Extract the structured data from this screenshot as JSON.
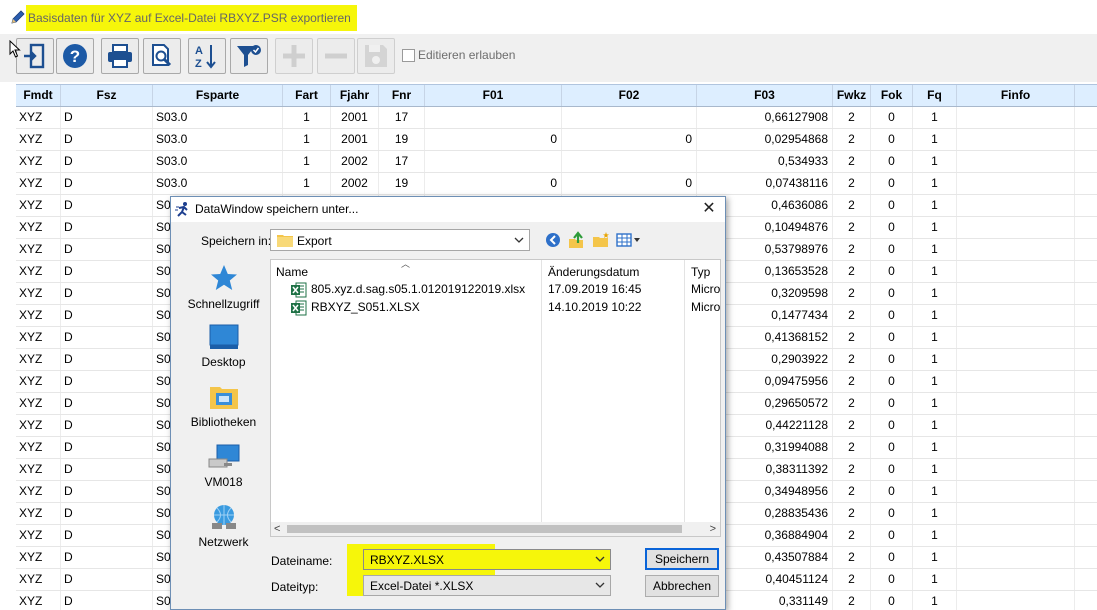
{
  "window": {
    "title": "Basisdaten für XYZ auf Excel-Datei RBXYZ.PSR exportieren"
  },
  "toolbar": {
    "buttons": [
      {
        "name": "exit",
        "icon": "exit-door-icon"
      },
      {
        "name": "help",
        "icon": "help-icon"
      },
      {
        "name": "print",
        "icon": "printer-icon"
      },
      {
        "name": "preview",
        "icon": "print-preview-icon"
      },
      {
        "name": "sort",
        "icon": "sort-az-icon"
      },
      {
        "name": "filter",
        "icon": "filter-icon"
      },
      {
        "name": "add",
        "icon": "plus-icon"
      },
      {
        "name": "remove",
        "icon": "minus-icon"
      },
      {
        "name": "save",
        "icon": "floppy-icon"
      }
    ],
    "edit_checkbox_label": "Editieren erlauben",
    "edit_checkbox_checked": false
  },
  "grid": {
    "columns": [
      "Fmdt",
      "Fsz",
      "Fsparte",
      "Fart",
      "Fjahr",
      "Fnr",
      "F01",
      "F02",
      "F03",
      "Fwkz",
      "Fok",
      "Fq",
      "Finfo"
    ],
    "rows": [
      [
        "XYZ",
        "D",
        "S03.0",
        "1",
        "2001",
        "17",
        "",
        "",
        "0,66127908",
        "2",
        "0",
        "1",
        ""
      ],
      [
        "XYZ",
        "D",
        "S03.0",
        "1",
        "2001",
        "19",
        "0",
        "0",
        "0,02954868",
        "2",
        "0",
        "1",
        ""
      ],
      [
        "XYZ",
        "D",
        "S03.0",
        "1",
        "2002",
        "17",
        "",
        "",
        "0,534933",
        "2",
        "0",
        "1",
        ""
      ],
      [
        "XYZ",
        "D",
        "S03.0",
        "1",
        "2002",
        "19",
        "0",
        "0",
        "0,07438116",
        "2",
        "0",
        "1",
        ""
      ],
      [
        "XYZ",
        "D",
        "S0",
        "",
        "",
        "",
        "",
        "",
        "0,4636086",
        "2",
        "0",
        "1",
        ""
      ],
      [
        "XYZ",
        "D",
        "S0",
        "",
        "",
        "",
        "",
        "",
        "0,10494876",
        "2",
        "0",
        "1",
        ""
      ],
      [
        "XYZ",
        "D",
        "S0",
        "",
        "",
        "",
        "",
        "",
        "0,53798976",
        "2",
        "0",
        "1",
        ""
      ],
      [
        "XYZ",
        "D",
        "S0",
        "",
        "",
        "",
        "",
        "",
        "0,13653528",
        "2",
        "0",
        "1",
        ""
      ],
      [
        "XYZ",
        "D",
        "S0",
        "",
        "",
        "",
        "",
        "",
        "0,3209598",
        "2",
        "0",
        "1",
        ""
      ],
      [
        "XYZ",
        "D",
        "S0",
        "",
        "",
        "",
        "",
        "",
        "0,1477434",
        "2",
        "0",
        "1",
        ""
      ],
      [
        "XYZ",
        "D",
        "S0",
        "",
        "",
        "",
        "",
        "",
        "0,41368152",
        "2",
        "0",
        "1",
        ""
      ],
      [
        "XYZ",
        "D",
        "S0",
        "",
        "",
        "",
        "",
        "",
        "0,2903922",
        "2",
        "0",
        "1",
        ""
      ],
      [
        "XYZ",
        "D",
        "S0",
        "",
        "",
        "",
        "",
        "",
        "0,09475956",
        "2",
        "0",
        "1",
        ""
      ],
      [
        "XYZ",
        "D",
        "S0",
        "",
        "",
        "",
        "",
        "",
        "0,29650572",
        "2",
        "0",
        "1",
        ""
      ],
      [
        "XYZ",
        "D",
        "S0",
        "",
        "",
        "",
        "",
        "",
        "0,44221128",
        "2",
        "0",
        "1",
        ""
      ],
      [
        "XYZ",
        "D",
        "S0",
        "",
        "",
        "",
        "",
        "",
        "0,31994088",
        "2",
        "0",
        "1",
        ""
      ],
      [
        "XYZ",
        "D",
        "S0",
        "",
        "",
        "",
        "",
        "",
        "0,38311392",
        "2",
        "0",
        "1",
        ""
      ],
      [
        "XYZ",
        "D",
        "S0",
        "",
        "",
        "",
        "",
        "",
        "0,34948956",
        "2",
        "0",
        "1",
        ""
      ],
      [
        "XYZ",
        "D",
        "S0",
        "",
        "",
        "",
        "",
        "",
        "0,28835436",
        "2",
        "0",
        "1",
        ""
      ],
      [
        "XYZ",
        "D",
        "S0",
        "",
        "",
        "",
        "",
        "",
        "0,36884904",
        "2",
        "0",
        "1",
        ""
      ],
      [
        "XYZ",
        "D",
        "S0",
        "",
        "",
        "",
        "",
        "",
        "0,43507884",
        "2",
        "0",
        "1",
        ""
      ],
      [
        "XYZ",
        "D",
        "S0",
        "",
        "",
        "",
        "",
        "",
        "0,40451124",
        "2",
        "0",
        "1",
        ""
      ],
      [
        "XYZ",
        "D",
        "S0",
        "",
        "",
        "",
        "",
        "",
        "0,331149",
        "2",
        "0",
        "1",
        ""
      ]
    ]
  },
  "dialog": {
    "title": "DataWindow speichern unter...",
    "save_in_label": "Speichern in:",
    "save_in_value": "Export",
    "places": [
      {
        "label": "Schnellzugriff",
        "icon": "star-icon"
      },
      {
        "label": "Desktop",
        "icon": "desktop-icon"
      },
      {
        "label": "Bibliotheken",
        "icon": "library-icon"
      },
      {
        "label": "VM018",
        "icon": "computer-icon"
      },
      {
        "label": "Netzwerk",
        "icon": "network-icon"
      }
    ],
    "columns": {
      "name": "Name",
      "date": "Änderungsdatum",
      "type": "Typ"
    },
    "files": [
      {
        "name": "805.xyz.d.sag.s05.1.012019122019.xlsx",
        "date": "17.09.2019 16:45",
        "type": "Micro"
      },
      {
        "name": "RBXYZ_S051.XLSX",
        "date": "14.10.2019 10:22",
        "type": "Micro"
      }
    ],
    "filename_label": "Dateiname:",
    "filename_value": "RBXYZ.XLSX",
    "filetype_label": "Dateityp:",
    "filetype_value": "Excel-Datei *.XLSX",
    "save_button": "Speichern",
    "cancel_button": "Abbrechen"
  },
  "colors": {
    "highlight": "#f6f60a",
    "grid_header": "#ddeeff",
    "help_blue": "#1d5aa6",
    "excel_green": "#1e7145",
    "default_button_border": "#0a64d8"
  }
}
